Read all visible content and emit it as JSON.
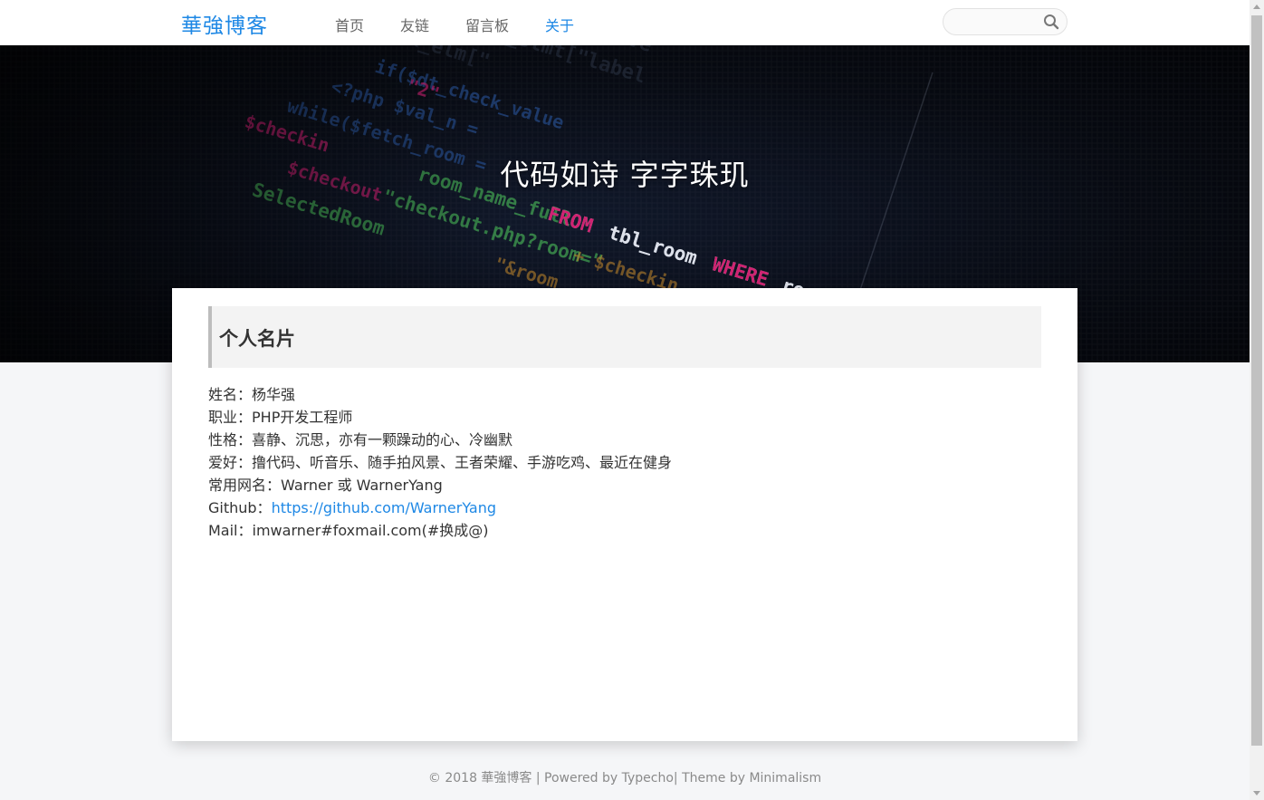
{
  "brand": {
    "name": "華強博客"
  },
  "nav": {
    "items": [
      {
        "label": "首页"
      },
      {
        "label": "友链"
      },
      {
        "label": "留言板"
      },
      {
        "label": "关于"
      }
    ],
    "active": "关于"
  },
  "search": {
    "placeholder": "",
    "icon": "search-icon"
  },
  "hero": {
    "title": "代码如诗 字字珠玑"
  },
  "card": {
    "heading": "个人名片",
    "fields": [
      {
        "label": "姓名：",
        "value": "杨华强"
      },
      {
        "label": "职业：",
        "value": "PHP开发工程师"
      },
      {
        "label": "性格：",
        "value": "喜静、沉思，亦有一颗躁动的心、冷幽默"
      },
      {
        "label": "爱好：",
        "value": "撸代码、听音乐、随手拍风景、王者荣耀、手游吃鸡、最近在健身"
      },
      {
        "label": "常用网名：",
        "value": "Warner 或 WarnerYang"
      },
      {
        "label": "Github：",
        "value": "https://github.com/WarnerYang"
      },
      {
        "label": "Mail：",
        "value": "imwarner#foxmail.com(#换成@)"
      }
    ]
  },
  "footer": {
    "text": "© 2018 華強博客 | Powered by Typecho| Theme by Minimalism"
  },
  "colors": {
    "accent": "#1e88e5",
    "heading_border": "#bdbdbd"
  }
}
